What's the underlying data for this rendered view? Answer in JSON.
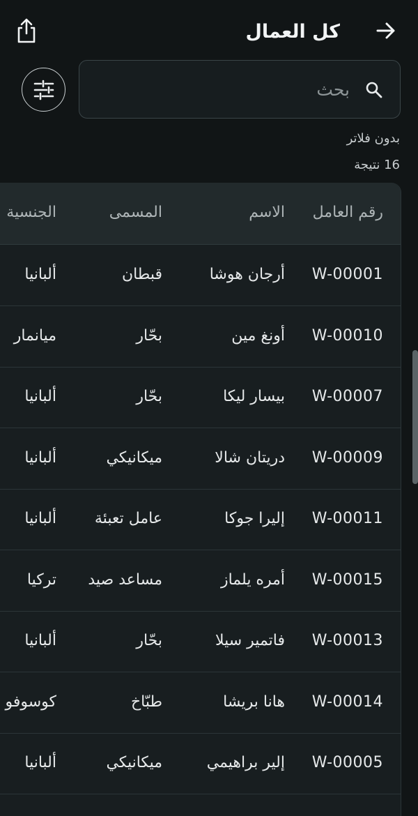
{
  "header": {
    "title": "كل العمال"
  },
  "search": {
    "placeholder": "بحث",
    "value": ""
  },
  "filter_status": "بدون فلاتر",
  "results_count": "16 نتيجة",
  "table": {
    "columns": [
      "رقم العامل",
      "الاسم",
      "المسمى",
      "الجنسية"
    ],
    "rows": [
      {
        "id": "W-00001",
        "name": "أرجان هوشا",
        "role": "قبطان",
        "nationality": "ألبانيا"
      },
      {
        "id": "W-00010",
        "name": "أونغ مين",
        "role": "بحّار",
        "nationality": "ميانمار"
      },
      {
        "id": "W-00007",
        "name": "بيسار ليكا",
        "role": "بحّار",
        "nationality": "ألبانيا"
      },
      {
        "id": "W-00009",
        "name": "دريتان شالا",
        "role": "ميكانيكي",
        "nationality": "ألبانيا"
      },
      {
        "id": "W-00011",
        "name": "إليرا جوكا",
        "role": "عامل تعبئة",
        "nationality": "ألبانيا"
      },
      {
        "id": "W-00015",
        "name": "أمره يلماز",
        "role": "مساعد صيد",
        "nationality": "تركيا"
      },
      {
        "id": "W-00013",
        "name": "فاتمير سيلا",
        "role": "بحّار",
        "nationality": "ألبانيا"
      },
      {
        "id": "W-00014",
        "name": "هانا بريشا",
        "role": "طبّاخ",
        "nationality": "كوسوفو"
      },
      {
        "id": "W-00005",
        "name": "إلير براهيمي",
        "role": "ميكانيكي",
        "nationality": "ألبانيا"
      }
    ]
  },
  "icons": {
    "back": "arrow-right-icon",
    "share": "share-icon",
    "search": "search-icon",
    "filter": "sliders-icon"
  }
}
